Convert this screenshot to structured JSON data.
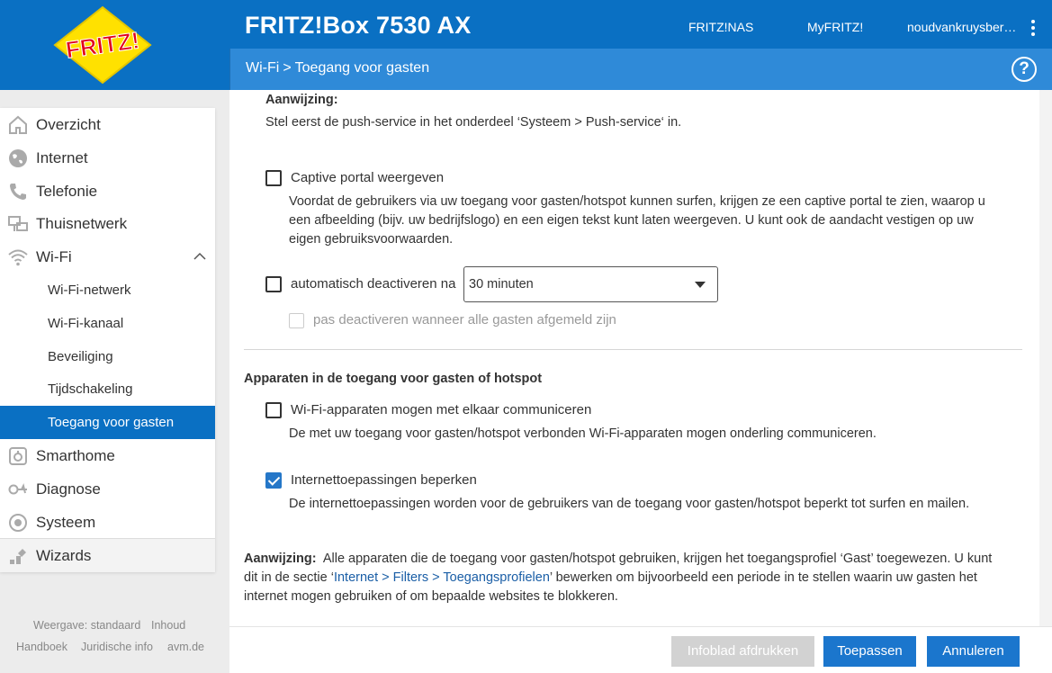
{
  "header": {
    "logo_text": "FRITZ!",
    "product": "FRITZ!Box 7530 AX",
    "links": [
      "FRITZ!NAS",
      "MyFRITZ!",
      "noudvankruysber…"
    ]
  },
  "breadcrumb": {
    "parent": "Wi-Fi",
    "separator": ">",
    "current": "Toegang voor gasten",
    "help": "?"
  },
  "sidebar": {
    "items": [
      {
        "label": "Overzicht",
        "icon": "home-icon"
      },
      {
        "label": "Internet",
        "icon": "globe-icon"
      },
      {
        "label": "Telefonie",
        "icon": "phone-icon"
      },
      {
        "label": "Thuisnetwerk",
        "icon": "network-icon"
      },
      {
        "label": "Wi-Fi",
        "icon": "wifi-icon"
      }
    ],
    "subitems": [
      "Wi-Fi-netwerk",
      "Wi-Fi-kanaal",
      "Beveiliging",
      "Tijdschakeling",
      "Toegang voor gasten"
    ],
    "items2": [
      {
        "label": "Smarthome",
        "icon": "smarthome-icon"
      },
      {
        "label": "Diagnose",
        "icon": "diagnose-icon"
      },
      {
        "label": "Systeem",
        "icon": "system-icon"
      },
      {
        "label": "Wizards",
        "icon": "wizard-icon"
      }
    ]
  },
  "footer_links": {
    "view": "Weergave: standaard",
    "contents": "Inhoud",
    "manual": "Handboek",
    "legal": "Juridische info",
    "site": "avm.de"
  },
  "content": {
    "hint1_title": "Aanwijzing:",
    "hint1_text": "Stel eerst de push-service in het onderdeel ‘Systeem > Push-service‘ in.",
    "captive_label": "Captive portal weergeven",
    "captive_desc_1": "Voordat de gebruikers via uw toegang voor gasten/hotspot kunnen surfen, krijgen ze een captive portal te zien, waarop u",
    "captive_desc_2": "een afbeelding (bijv. uw bedrijfslogo) en een eigen tekst kunt laten weergeven. U kunt ook de aandacht vestigen op uw",
    "captive_desc_3": "eigen gebruiksvoorwaarden.",
    "auto_label": "automatisch deactiveren na",
    "auto_value": "30 minuten",
    "auto_sub_label": "pas deactiveren wanneer alle gasten afgemeld zijn",
    "section_title": "Apparaten in de toegang voor gasten of hotspot",
    "comm_label": "Wi-Fi-apparaten mogen met elkaar communiceren",
    "comm_desc": "De met uw toegang voor gasten/hotspot verbonden Wi-Fi-apparaten mogen onderling communiceren.",
    "restrict_label": "Internettoepassingen beperken",
    "restrict_desc": "De internettoepassingen worden voor de gebruikers van de toegang voor gasten/hotspot beperkt tot surfen en mailen.",
    "hint2_title": "Aanwijzing:",
    "hint2_line1": "Alle apparaten die de toegang voor gasten/hotspot gebruiken, krijgen het toegangsprofiel ‘Gast’ toegewezen. U kunt",
    "hint2_line2_pre": "dit in de sectie ‘",
    "hint2_link": "Internet > Filters > Toegangsprofielen",
    "hint2_line2_post": "’ bewerken om bijvoorbeeld een periode in te stellen waarin uw gasten het",
    "hint2_line3": "internet mogen gebruiken of om bepaalde websites te blokkeren."
  },
  "buttons": {
    "print": "Infoblad afdrukken",
    "apply": "Toepassen",
    "cancel": "Annuleren"
  },
  "colors": {
    "primary": "#0a70c3",
    "subbar": "#2f8ad8",
    "checkbox": "#2577c8"
  }
}
